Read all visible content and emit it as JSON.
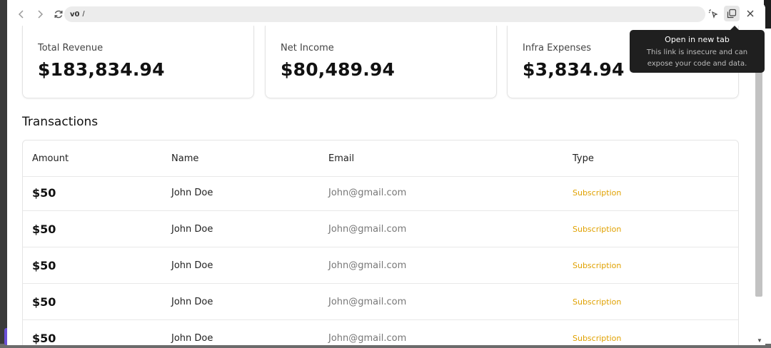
{
  "browser": {
    "url_logo": "v0",
    "url_path": "/"
  },
  "cards": [
    {
      "title": "Total Revenue",
      "value": "$183,834.94"
    },
    {
      "title": "Net Income",
      "value": "$80,489.94"
    },
    {
      "title": "Infra Expenses",
      "value": "$3,834.94"
    }
  ],
  "transactions": {
    "title": "Transactions",
    "columns": {
      "amount": "Amount",
      "name": "Name",
      "email": "Email",
      "type": "Type"
    },
    "rows": [
      {
        "amount": "$50",
        "name": "John Doe",
        "email": "John@gmail.com",
        "type": "Subscription"
      },
      {
        "amount": "$50",
        "name": "John Doe",
        "email": "John@gmail.com",
        "type": "Subscription"
      },
      {
        "amount": "$50",
        "name": "John Doe",
        "email": "John@gmail.com",
        "type": "Subscription"
      },
      {
        "amount": "$50",
        "name": "John Doe",
        "email": "John@gmail.com",
        "type": "Subscription"
      },
      {
        "amount": "$50",
        "name": "John Doe",
        "email": "John@gmail.com",
        "type": "Subscription"
      }
    ]
  },
  "tooltip": {
    "title": "Open in new tab",
    "line1": "This link is insecure and can",
    "line2": "expose your code and data."
  },
  "colors": {
    "type_accent": "#e0a100",
    "tooltip_bg": "#1f1f1f"
  }
}
